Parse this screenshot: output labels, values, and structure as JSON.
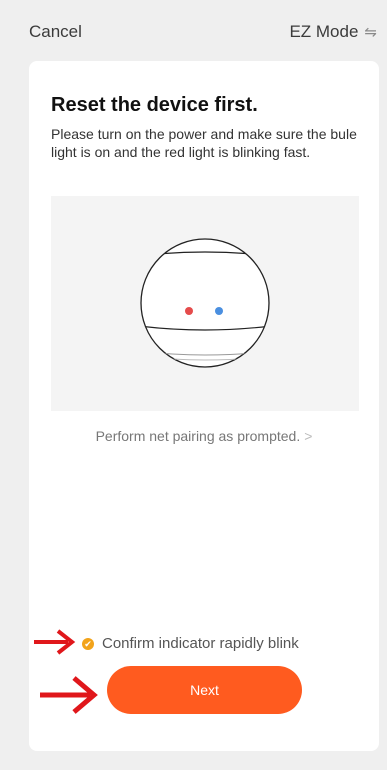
{
  "header": {
    "cancel_label": "Cancel",
    "mode_label": "EZ Mode",
    "mode_icon": "⇋"
  },
  "card": {
    "title": "Reset the device first.",
    "description": "Please turn on the power and make sure the bule light is on and the red light is blinking fast.",
    "prompt_link": "Perform net pairing as prompted.",
    "prompt_chevron": ">",
    "confirm_label": "Confirm indicator rapidly blink",
    "next_label": "Next"
  },
  "colors": {
    "accent": "#ff5b1f",
    "check": "#f2a31a",
    "red_led": "#e54b4b",
    "blue_led": "#4a8fe0",
    "annotation_arrow": "#e0171b"
  },
  "icons": {
    "confirm": "check-circle-icon",
    "mode": "switch-arrows-icon"
  }
}
